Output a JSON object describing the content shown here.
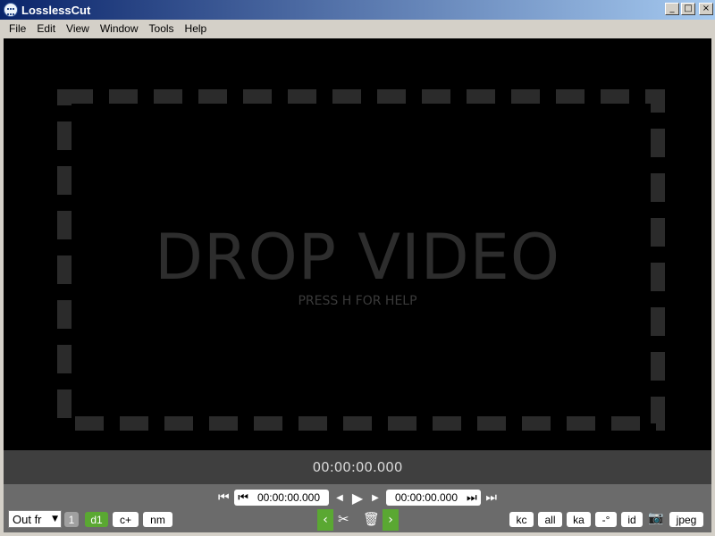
{
  "window": {
    "title": "LosslessCut",
    "minimize": "_",
    "maximize": "□",
    "close": "×"
  },
  "menu": {
    "items": [
      "File",
      "Edit",
      "View",
      "Window",
      "Tools",
      "Help"
    ]
  },
  "stage": {
    "title": "DROP VIDEO",
    "subtitle": "PRESS H FOR HELP"
  },
  "timeline": {
    "current_time": "00:00:00.000"
  },
  "controls": {
    "cut_start_time": "00:00:00.000",
    "cut_end_time": "00:00:00.000",
    "output_format": "Out fr",
    "segment_number": "1",
    "buttons": {
      "d1": "d1",
      "c_plus": "c+",
      "nm": "nm",
      "kc": "kc",
      "all": "all",
      "ka": "ka",
      "rotate": "-°",
      "id": "id",
      "jpeg": "jpeg"
    },
    "icons": {
      "jump_start": "skip-start-icon",
      "step_back": "step-back-icon",
      "play": "play-icon",
      "step_forward": "step-forward-icon",
      "jump_end": "skip-end-icon",
      "cut_start_marker": "cut-start-icon",
      "cut_end_marker": "cut-end-icon",
      "prev_segment": "chevron-left-icon",
      "next_segment": "chevron-right-icon",
      "cut": "scissors-icon",
      "delete": "trash-icon",
      "screenshot": "camera-icon"
    }
  },
  "colors": {
    "accent_green": "#5aa832",
    "stage_background": "#000000",
    "drop_frame": "#2b2b2b",
    "time_strip": "#3f3f3f",
    "controls_background": "#6b6b6b"
  }
}
